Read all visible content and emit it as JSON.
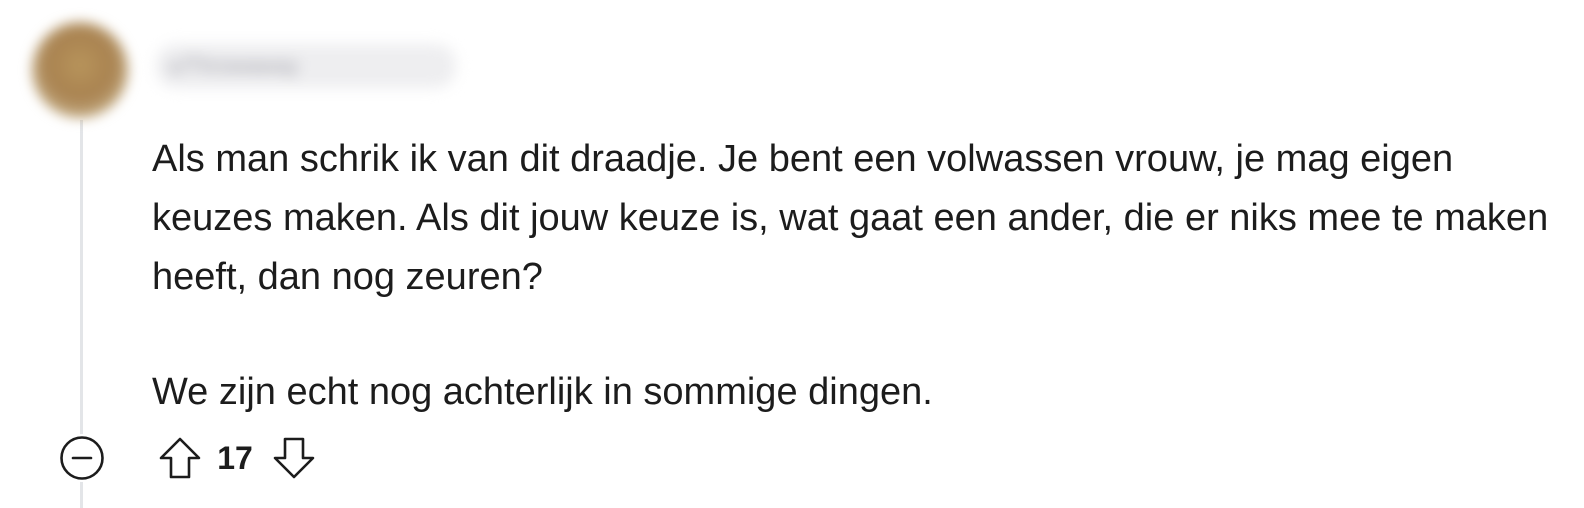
{
  "comment": {
    "author": "u/Throwaway",
    "paragraphs": [
      "Als man schrik ik van dit draadje. Je bent een volwassen vrouw, je mag eigen keuzes maken. Als dit jouw keuze is, wat gaat een ander, die er niks mee te maken heeft, dan nog zeuren?",
      "We zijn echt nog achterlijk in sommige dingen."
    ],
    "score": "17"
  },
  "icons": {
    "collapse": "minus-circle-icon",
    "upvote": "arrow-up-icon",
    "downvote": "arrow-down-icon"
  }
}
